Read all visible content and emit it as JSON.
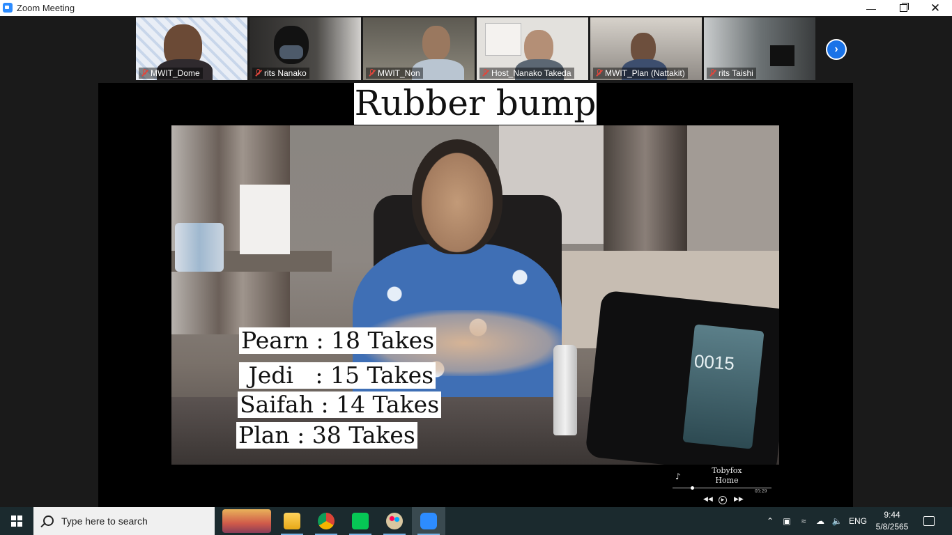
{
  "window": {
    "title": "Zoom Meeting",
    "minimize_icon": "minimize-icon",
    "restore_icon": "restore-icon",
    "close_icon": "close-icon"
  },
  "participants": [
    {
      "name": "MWIT_Dome",
      "muted": true,
      "bg": "#cfd9e6"
    },
    {
      "name": "rits Nanako",
      "muted": true,
      "bg": "#3c3b3b"
    },
    {
      "name": "MWIT_Non",
      "muted": true,
      "bg": "#6f6c63",
      "active": true
    },
    {
      "name": "Host_Nanako Takeda",
      "muted": true,
      "bg": "#d8d6d2"
    },
    {
      "name": "MWIT_Plan (Nattakit)",
      "muted": true,
      "bg": "#9a9793"
    },
    {
      "name": "rits Taishi",
      "muted": true,
      "bg": "#7f8486"
    }
  ],
  "share": {
    "heading": "Rubber bump",
    "takes": [
      "Pearn : 18 Takes",
      " Jedi   : 15 Takes",
      "Saifah : 14 Takes",
      "Plan : 38 Takes"
    ],
    "counter": "0015",
    "music": {
      "artist": "Tobyfox",
      "track": "Home",
      "time": "05:29"
    }
  },
  "taskbar": {
    "search_placeholder": "Type here to search",
    "language": "ENG",
    "time": "9:44",
    "date": "5/8/2565",
    "apps": [
      "widgets-icon",
      "file-explorer-icon",
      "chrome-icon",
      "line-icon",
      "paint-icon",
      "zoom-icon"
    ]
  }
}
